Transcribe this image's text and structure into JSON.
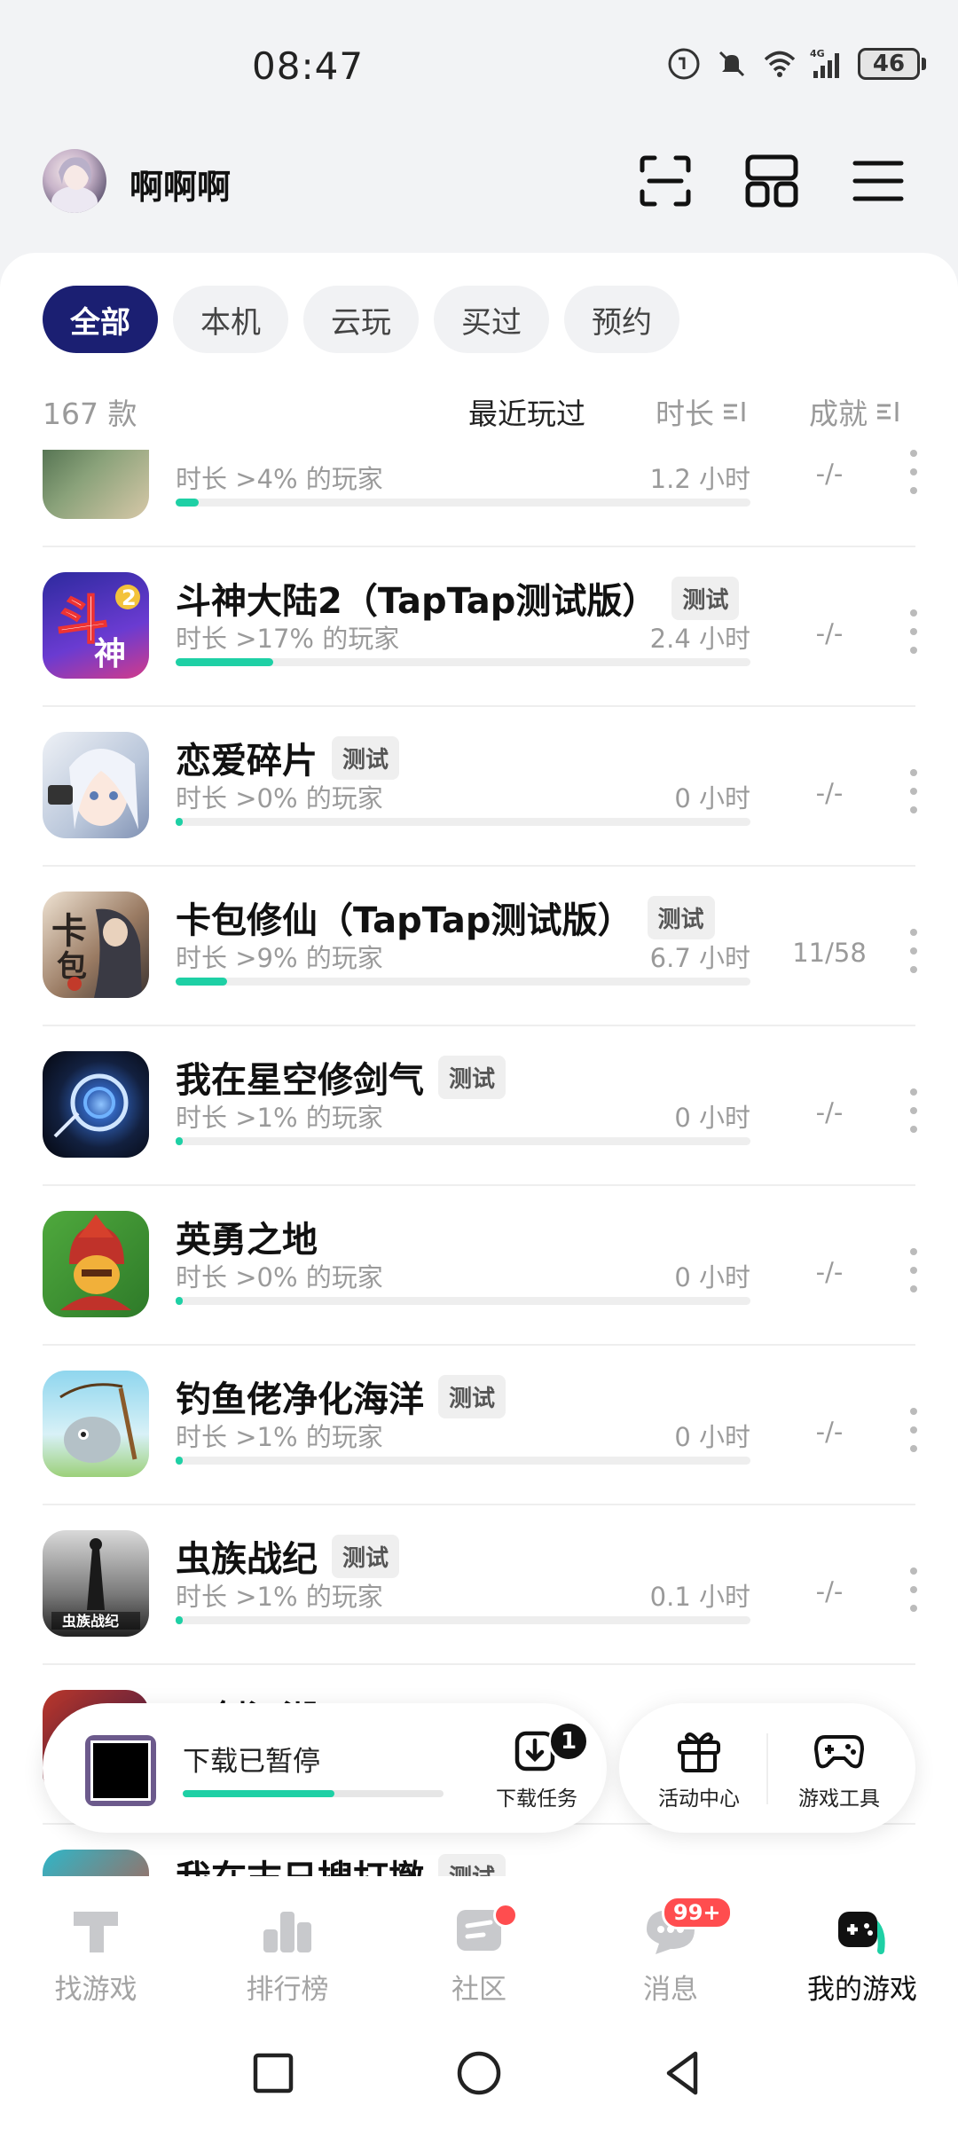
{
  "status_bar": {
    "time": "08:47",
    "battery": "46"
  },
  "header": {
    "user_name": "啊啊啊"
  },
  "filters": {
    "chips": [
      "全部",
      "本机",
      "云玩",
      "买过",
      "预约"
    ],
    "count": "167 款",
    "sort_recent": "最近玩过",
    "sort_duration": "时长",
    "sort_achievement": "成就"
  },
  "games": [
    {
      "title": "",
      "tag": "",
      "sub": "时长 >4% 的玩家",
      "hours": "1.2 小时",
      "achievement": "-/-",
      "progress": 0.04,
      "icon_color": "#4f6a4a"
    },
    {
      "title": "斗神大陆2（TapTap测试版）",
      "tag": "测试",
      "sub": "时长 >17% 的玩家",
      "hours": "2.4 小时",
      "achievement": "-/-",
      "progress": 0.17,
      "icon_color": "#3a2d9c"
    },
    {
      "title": "恋爱碎片",
      "tag": "测试",
      "sub": "时长 >0% 的玩家",
      "hours": "0 小时",
      "achievement": "-/-",
      "progress": 0.0,
      "icon_color": "#cfd6e2"
    },
    {
      "title": "卡包修仙（TapTap测试版）",
      "tag": "测试",
      "sub": "时长 >9% 的玩家",
      "hours": "6.7 小时",
      "achievement": "11/58",
      "progress": 0.09,
      "icon_color": "#7a5b46"
    },
    {
      "title": "我在星空修剑气",
      "tag": "测试",
      "sub": "时长 >1% 的玩家",
      "hours": "0 小时",
      "achievement": "-/-",
      "progress": 0.01,
      "icon_color": "#1c2c4e"
    },
    {
      "title": "英勇之地",
      "tag": "",
      "sub": "时长 >0% 的玩家",
      "hours": "0 小时",
      "achievement": "-/-",
      "progress": 0.0,
      "icon_color": "#d5401d"
    },
    {
      "title": "钓鱼佬净化海洋",
      "tag": "测试",
      "sub": "时长 >1% 的玩家",
      "hours": "0 小时",
      "achievement": "-/-",
      "progress": 0.01,
      "icon_color": "#8ed0e6"
    },
    {
      "title": "虫族战纪",
      "tag": "测试",
      "sub": "时长 >1% 的玩家",
      "hours": "0.1 小时",
      "achievement": "-/-",
      "progress": 0.01,
      "icon_color": "#5a5a5a"
    },
    {
      "title": "一剑江湖",
      "tag": "",
      "sub": "",
      "hours": "",
      "achievement": "",
      "progress": 0.0,
      "icon_color": "#b8362a"
    },
    {
      "title": "我在末日搜打撤",
      "tag": "测试",
      "sub": "",
      "hours": "",
      "achievement": "",
      "progress": 0.0,
      "icon_color": "#c8503b"
    }
  ],
  "download": {
    "status": "下载已暂停",
    "task_label": "下载任务",
    "task_count": "1",
    "progress": 0.58
  },
  "tools": {
    "events_label": "活动中心",
    "game_tools_label": "游戏工具"
  },
  "nav": {
    "items": [
      "找游戏",
      "排行榜",
      "社区",
      "消息",
      "我的游戏"
    ],
    "messages_badge": "99+",
    "active_index": 4
  },
  "colors": {
    "accent": "#1ed0a5",
    "chip_active": "#1b1f72",
    "badge": "#ff4d4f"
  }
}
